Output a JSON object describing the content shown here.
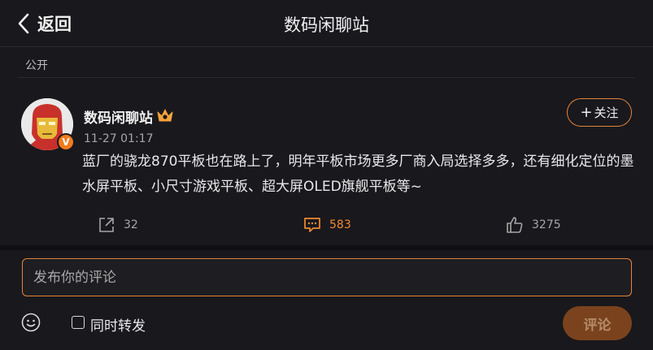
{
  "header": {
    "back_label": "返回",
    "title": "数码闲聊站"
  },
  "post": {
    "visibility": "公开",
    "author": "数码闲聊站",
    "verified_badge": "V",
    "timestamp": "11-27 01:17",
    "follow_label": "关注",
    "text": "蓝厂的骁龙870平板也在路上了，明年平板市场更多厂商入局选择多多，还有细化定位的墨水屏平板、小尺寸游戏平板、超大屏OLED旗舰平板等~",
    "stats": {
      "reposts": "32",
      "comments": "583",
      "likes": "3275"
    }
  },
  "composer": {
    "placeholder": "发布你的评论",
    "repost_label": "同时转发",
    "submit_label": "评论",
    "repost_checked": false
  },
  "colors": {
    "accent": "#f08a2f",
    "background": "#19181d",
    "submit_bg": "#7a431d"
  },
  "icons": [
    "chevron-left-icon",
    "crown-icon",
    "share-icon",
    "comment-icon",
    "like-icon",
    "emoji-icon"
  ]
}
